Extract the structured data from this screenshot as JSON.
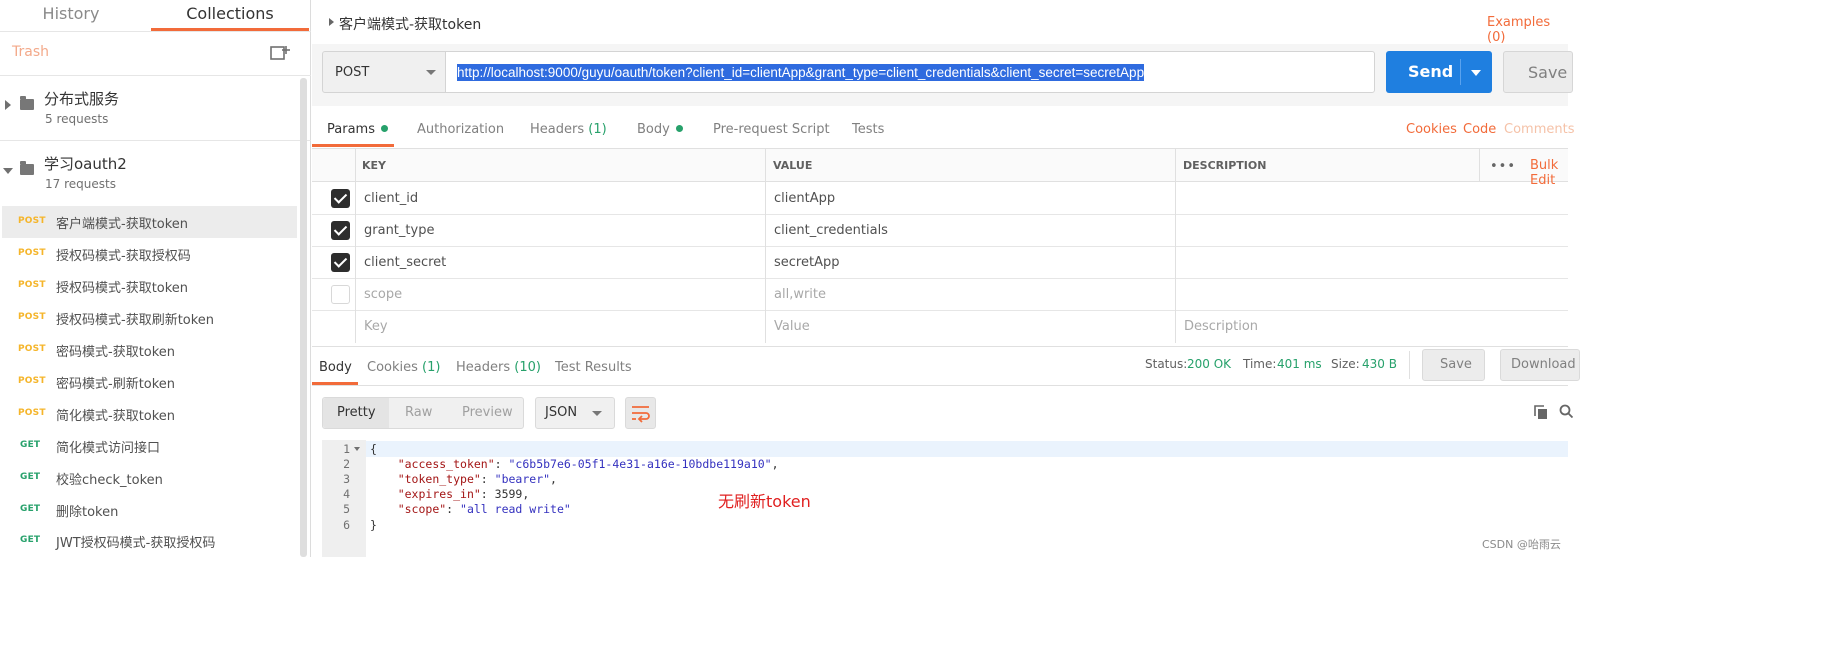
{
  "sidebar": {
    "tabs": {
      "history": "History",
      "collections": "Collections"
    },
    "trash": "Trash",
    "collections": [
      {
        "name": "分布式服务",
        "count": "5 requests"
      },
      {
        "name": "学习oauth2",
        "count": "17 requests"
      }
    ],
    "requests": [
      {
        "method": "POST",
        "name": "客户端模式-获取token"
      },
      {
        "method": "POST",
        "name": "授权码模式-获取授权码"
      },
      {
        "method": "POST",
        "name": "授权码模式-获取token"
      },
      {
        "method": "POST",
        "name": "授权码模式-获取刷新token"
      },
      {
        "method": "POST",
        "name": "密码模式-获取token"
      },
      {
        "method": "POST",
        "name": "密码模式-刷新token"
      },
      {
        "method": "POST",
        "name": "简化模式-获取token"
      },
      {
        "method": "GET",
        "name": "简化模式访问接口"
      },
      {
        "method": "GET",
        "name": "校验check_token"
      },
      {
        "method": "GET",
        "name": "删除token"
      },
      {
        "method": "GET",
        "name": "JWT授权码模式-获取授权码"
      }
    ]
  },
  "request": {
    "title": "客户端模式-获取token",
    "examples": "Examples (0)",
    "method": "POST",
    "url": "http://localhost:9000/guyu/oauth/token?client_id=clientApp&grant_type=client_credentials&client_secret=secretApp",
    "send_label": "Send",
    "save_label": "Save"
  },
  "request_tabs": {
    "params": "Params",
    "authorization": "Authorization",
    "headers": "Headers",
    "headers_count": "(1)",
    "body": "Body",
    "prerequest": "Pre-request Script",
    "tests": "Tests",
    "cookies": "Cookies",
    "code": "Code",
    "comments": "Comments"
  },
  "params_table": {
    "headers": {
      "key": "KEY",
      "value": "VALUE",
      "description": "DESCRIPTION"
    },
    "more": "•••",
    "bulk_edit": "Bulk Edit",
    "rows": [
      {
        "checked": true,
        "key": "client_id",
        "value": "clientApp"
      },
      {
        "checked": true,
        "key": "grant_type",
        "value": "client_credentials"
      },
      {
        "checked": true,
        "key": "client_secret",
        "value": "secretApp"
      },
      {
        "checked": false,
        "key": "scope",
        "value": "all,write"
      }
    ],
    "placeholder": {
      "key": "Key",
      "value": "Value",
      "description": "Description"
    }
  },
  "response_tabs": {
    "body": "Body",
    "cookies": "Cookies",
    "cookies_count": "(1)",
    "headers": "Headers",
    "headers_count": "(10)",
    "test_results": "Test Results"
  },
  "response_status": {
    "status_label": "Status:",
    "status_value": "200 OK",
    "time_label": "Time:",
    "time_value": "401 ms",
    "size_label": "Size:",
    "size_value": "430 B",
    "save": "Save",
    "download": "Download"
  },
  "response_toolbar": {
    "pretty": "Pretty",
    "raw": "Raw",
    "preview": "Preview",
    "format": "JSON"
  },
  "response_body": {
    "line_numbers": [
      "1",
      "2",
      "3",
      "4",
      "5",
      "6"
    ],
    "open_brace": "{",
    "close_brace": "}",
    "fields": [
      {
        "key": "\"access_token\"",
        "value": "\"c6b5b7e6-05f1-4e31-a16e-10bdbe119a10\"",
        "sep": ","
      },
      {
        "key": "\"token_type\"",
        "value": "\"bearer\"",
        "sep": ","
      },
      {
        "key": "\"expires_in\"",
        "value": "3599",
        "sep": ","
      },
      {
        "key": "\"scope\"",
        "value": "\"all read write\"",
        "sep": ""
      }
    ]
  },
  "annotation": "无刷新token",
  "watermark": "CSDN @咍雨云",
  "colors": {
    "accent": "#f26b3a",
    "send": "#1f7fe0",
    "post": "#f5b52a",
    "get": "#27a16b",
    "status_ok": "#27a16b",
    "annotation": "#e02020"
  }
}
